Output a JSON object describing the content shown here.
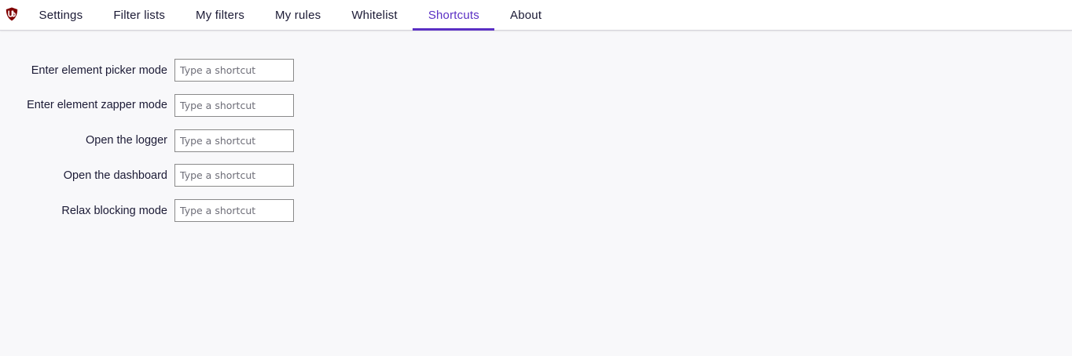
{
  "nav": {
    "logo_icon": "ublock-origin-shield-icon",
    "logo_color": "#800000",
    "accent_color": "#5a2fc4",
    "tabs": [
      {
        "label": "Settings",
        "active": false
      },
      {
        "label": "Filter lists",
        "active": false
      },
      {
        "label": "My filters",
        "active": false
      },
      {
        "label": "My rules",
        "active": false
      },
      {
        "label": "Whitelist",
        "active": false
      },
      {
        "label": "Shortcuts",
        "active": true
      },
      {
        "label": "About",
        "active": false
      }
    ]
  },
  "shortcuts": [
    {
      "label": "Enter element picker mode",
      "value": "",
      "placeholder": "Type a shortcut"
    },
    {
      "label": "Enter element zapper mode",
      "value": "",
      "placeholder": "Type a shortcut"
    },
    {
      "label": "Open the logger",
      "value": "",
      "placeholder": "Type a shortcut"
    },
    {
      "label": "Open the dashboard",
      "value": "",
      "placeholder": "Type a shortcut"
    },
    {
      "label": "Relax blocking mode",
      "value": "",
      "placeholder": "Type a shortcut"
    }
  ]
}
